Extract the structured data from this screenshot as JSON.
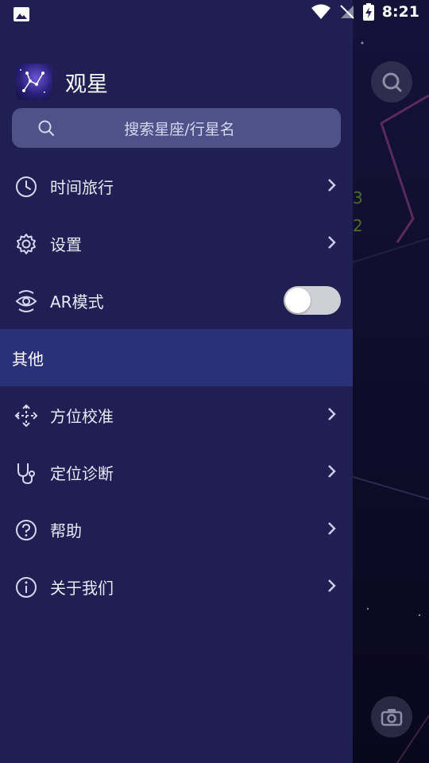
{
  "status_bar": {
    "time": "8:21"
  },
  "app": {
    "title": "观星"
  },
  "search": {
    "placeholder": "搜索星座/行星名"
  },
  "menu": {
    "time_travel": "时间旅行",
    "settings": "设置",
    "ar_mode": "AR模式",
    "ar_mode_enabled": false,
    "section_other": "其他",
    "calibrate": "方位校准",
    "location_diagnosis": "定位诊断",
    "help": "帮助",
    "about": "关于我们"
  },
  "background": {
    "numbers": [
      "3",
      "2"
    ]
  },
  "colors": {
    "drawer_bg": "#201f53",
    "section_bg": "#2b3179",
    "search_bg": "#4f5189",
    "toggle_off": "#cfcfd6"
  }
}
